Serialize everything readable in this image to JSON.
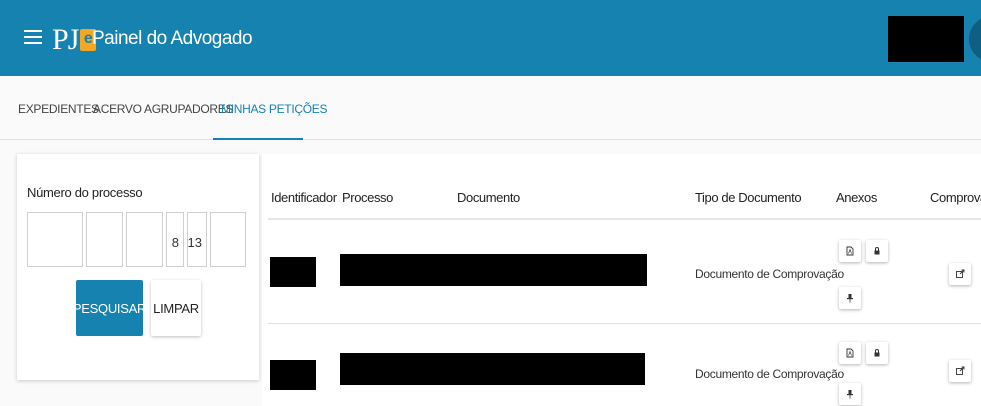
{
  "header": {
    "logo_text_p": "P",
    "logo_text_j": "J",
    "logo_text_e": "e",
    "title": "Painel do Advogado"
  },
  "tabs": [
    {
      "label": "EXPEDIENTES"
    },
    {
      "label": "ACERVO"
    },
    {
      "label": "AGRUPADORES"
    },
    {
      "label": "MINHAS PETIÇÕES"
    }
  ],
  "active_tab": "MINHAS PETIÇÕES",
  "filter": {
    "label": "Número do processo",
    "fields": [
      "",
      "",
      "",
      "8",
      "13",
      ""
    ],
    "search_button": "PESQUISAR",
    "clear_button": "LIMPAR"
  },
  "table": {
    "columns": [
      "Identificador",
      "Processo",
      "Documento",
      "Tipo de Documento",
      "Anexos",
      "Comprovante"
    ],
    "rows": [
      {
        "identificador": "",
        "processo": "",
        "tipo": "Documento de Comprovação"
      },
      {
        "identificador": "",
        "processo": "",
        "tipo": "Documento de Comprovação"
      }
    ]
  },
  "colors": {
    "header_bg": "#1682b0",
    "accent": "#1682b0",
    "logo_badge": "#f5a623"
  },
  "icons": [
    "menu-icon",
    "pdf-icon",
    "lock-icon",
    "pin-icon",
    "external-link-icon"
  ]
}
